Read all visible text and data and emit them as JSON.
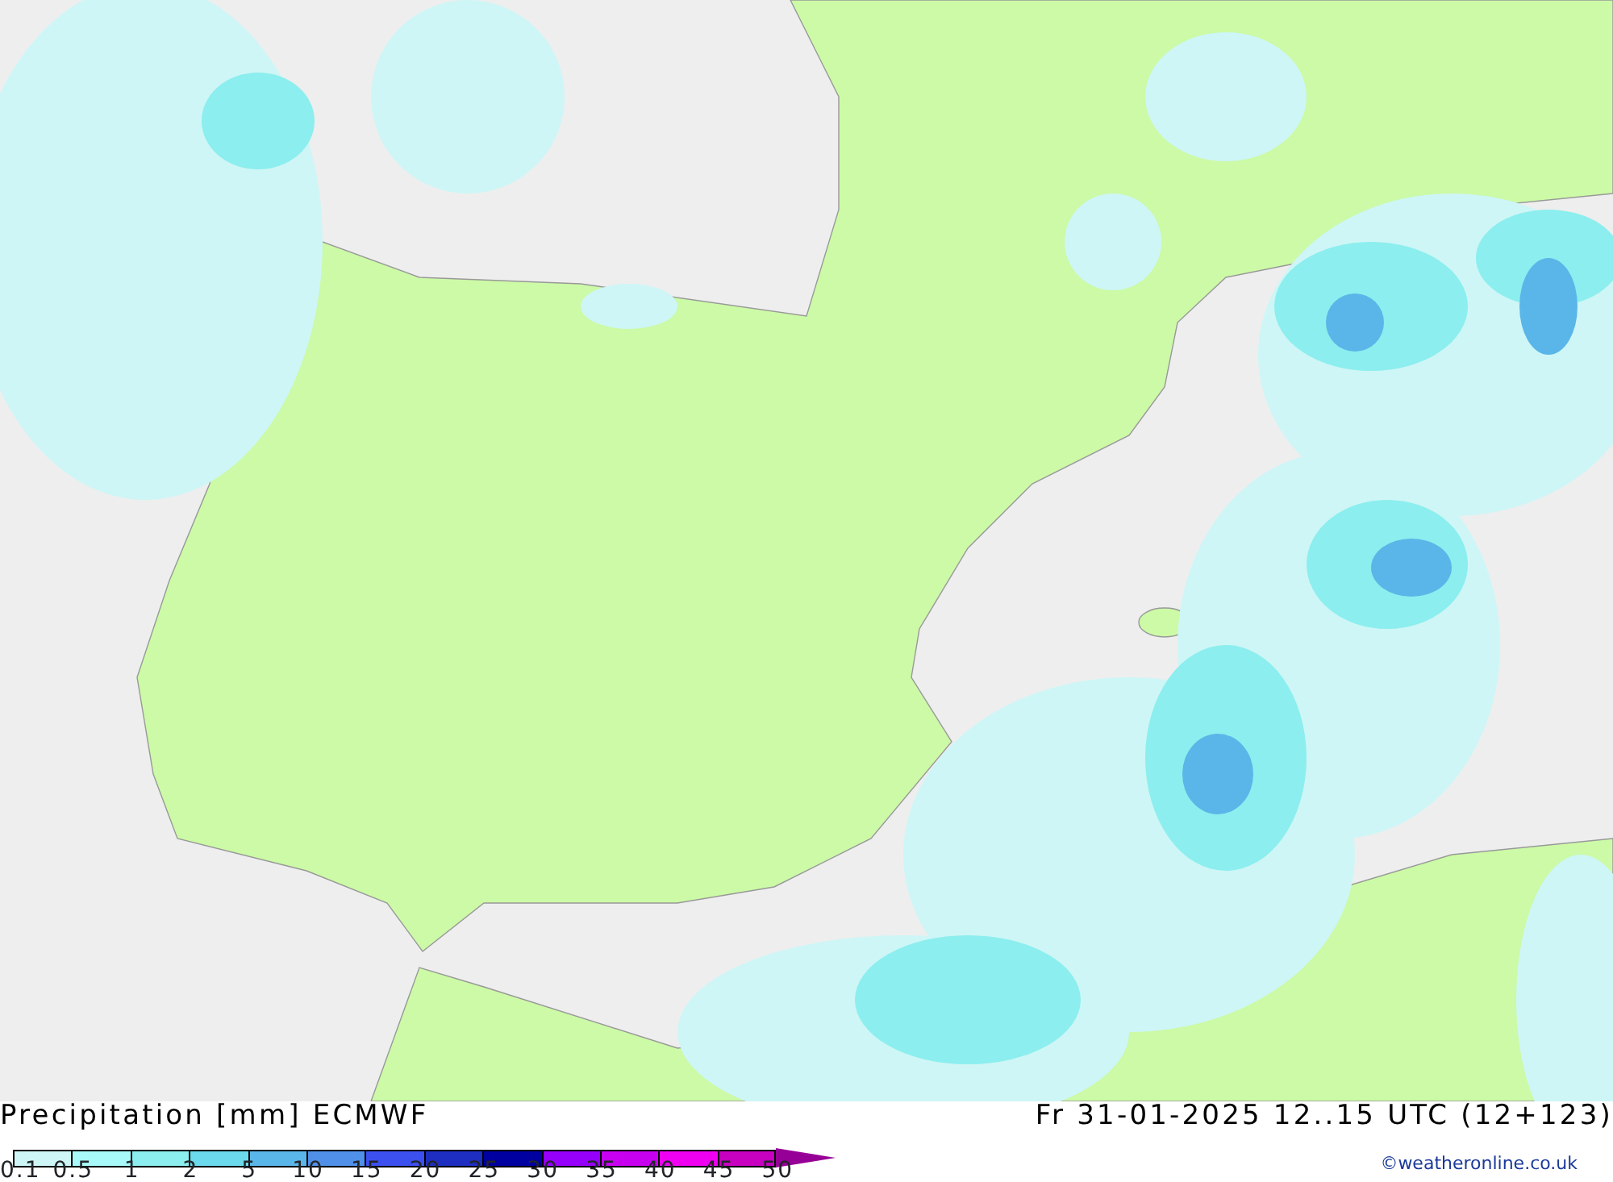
{
  "map": {
    "title": "Precipitation [mm] ECMWF",
    "valid_time": "Fr 31-01-2025 12..15 UTC (12+123)"
  },
  "legend": {
    "items": [
      {
        "label": "0.1",
        "color": "#cef6f6"
      },
      {
        "label": "0.5",
        "color": "#a8fafa"
      },
      {
        "label": "1",
        "color": "#8ceeee"
      },
      {
        "label": "2",
        "color": "#6adaec"
      },
      {
        "label": "5",
        "color": "#5ab6e8"
      },
      {
        "label": "10",
        "color": "#5090e8"
      },
      {
        "label": "15",
        "color": "#3c50f0"
      },
      {
        "label": "20",
        "color": "#1e2ec0"
      },
      {
        "label": "25",
        "color": "#0000a0"
      },
      {
        "label": "30",
        "color": "#9600fa"
      },
      {
        "label": "35",
        "color": "#c800f0"
      },
      {
        "label": "40",
        "color": "#f000f0"
      },
      {
        "label": "45",
        "color": "#c800c0"
      },
      {
        "label": "50",
        "color": "#960096"
      }
    ]
  },
  "credit": "©weatheronline.co.uk"
}
